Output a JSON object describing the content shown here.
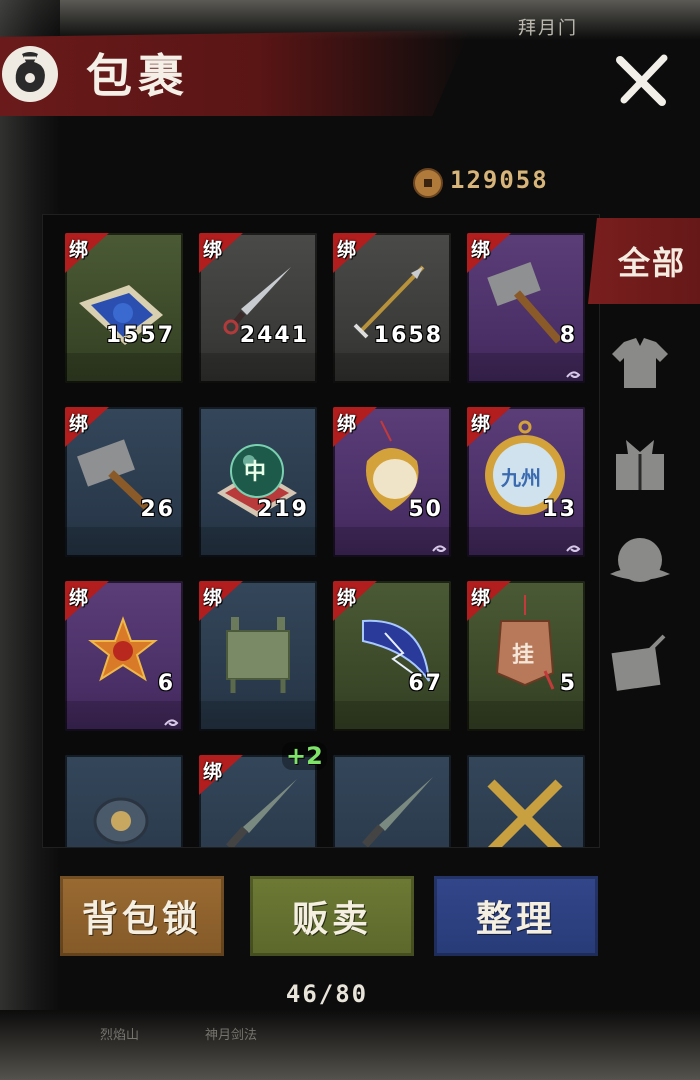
{
  "header": {
    "title": "包裹",
    "top_right_text": "拜月门"
  },
  "currency": {
    "icon": "copper-coin-icon",
    "amount": "129058"
  },
  "tabs": {
    "active_label": "全部",
    "icons": [
      "clothing-icon",
      "gift-box-icon",
      "hat-icon",
      "scroll-icon"
    ]
  },
  "bind_label": "绑",
  "inventory": {
    "items": [
      {
        "name": "blue-powder-icon",
        "bound": true,
        "qty": "1557",
        "rarity": "green"
      },
      {
        "name": "kunai-icon",
        "bound": true,
        "qty": "2441",
        "rarity": "gray"
      },
      {
        "name": "arrow-icon",
        "bound": true,
        "qty": "1658",
        "rarity": "gray"
      },
      {
        "name": "hammer-icon",
        "bound": true,
        "qty": "8",
        "rarity": "purple"
      },
      {
        "name": "hammer-icon",
        "bound": true,
        "qty": "26",
        "rarity": "blue"
      },
      {
        "name": "jade-orb-icon",
        "bound": false,
        "qty": "219",
        "rarity": "blue",
        "orb_text": "中"
      },
      {
        "name": "mirror-pendant-icon",
        "bound": true,
        "qty": "50",
        "rarity": "purple"
      },
      {
        "name": "medallion-icon",
        "bound": true,
        "qty": "13",
        "rarity": "purple",
        "medal_text": "九州"
      },
      {
        "name": "star-flower-icon",
        "bound": true,
        "qty": "6",
        "rarity": "purple"
      },
      {
        "name": "bronze-cauldron-icon",
        "bound": true,
        "qty": "",
        "rarity": "blue"
      },
      {
        "name": "crescent-blade-icon",
        "bound": true,
        "qty": "67",
        "rarity": "green"
      },
      {
        "name": "token-charm-icon",
        "bound": true,
        "qty": "5",
        "rarity": "green",
        "token_text": "挂"
      },
      {
        "name": "amulet-icon",
        "bound": false,
        "qty": "",
        "rarity": "blue"
      },
      {
        "name": "sword-icon",
        "bound": true,
        "qty": "",
        "rarity": "blue",
        "bonus": "+2"
      },
      {
        "name": "sword-icon",
        "bound": false,
        "qty": "",
        "rarity": "blue"
      },
      {
        "name": "crossed-drills-icon",
        "bound": false,
        "qty": "",
        "rarity": "blue"
      }
    ]
  },
  "buttons": {
    "lock": "背包锁",
    "sell": "贩卖",
    "sort": "整理"
  },
  "capacity": "46/80",
  "bottom_texts": [
    "烈焰山",
    "神月剑法"
  ],
  "colors": {
    "accent_red": "#6a1a1a",
    "coin_text": "#d7b47a",
    "bonus_green": "#7fe36a"
  }
}
